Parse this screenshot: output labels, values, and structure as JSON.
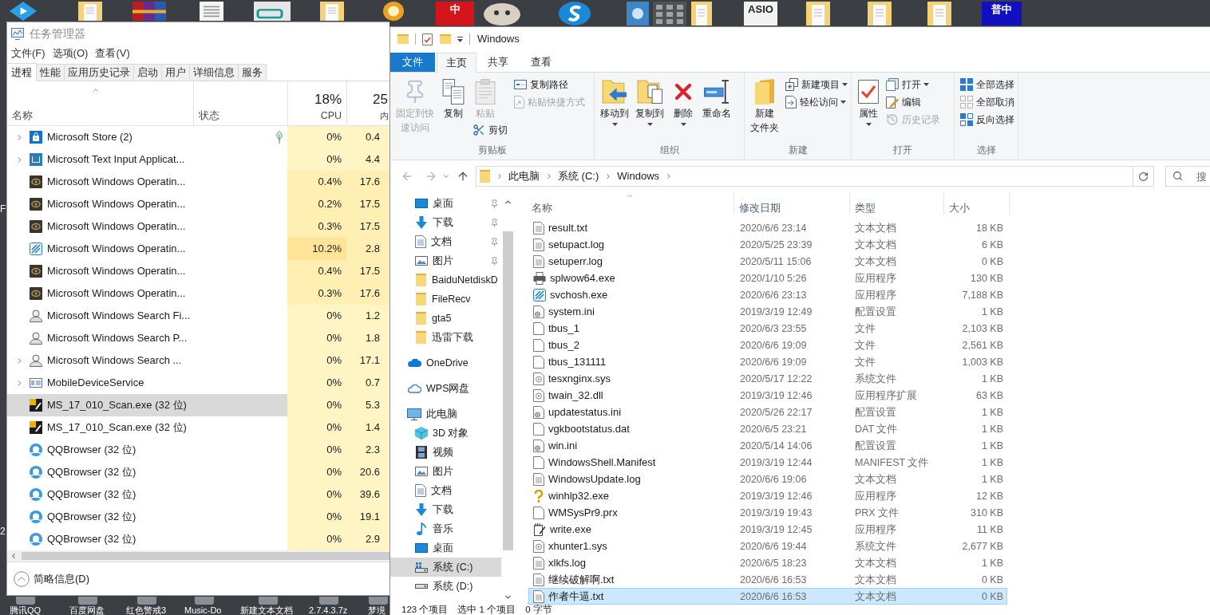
{
  "desktop": {
    "top_icons": [
      {
        "kind": "arrow"
      },
      {
        "kind": "folder"
      },
      {
        "kind": "archive"
      },
      {
        "kind": "document"
      },
      {
        "kind": "usb"
      },
      {
        "kind": "folder"
      },
      {
        "kind": "coin"
      },
      {
        "kind": "badge",
        "text": "中",
        "color": "#d4161c"
      },
      {
        "kind": "mascot"
      },
      {
        "kind": "swirl"
      },
      {
        "kind": "speaker"
      },
      {
        "kind": "keypad"
      },
      {
        "kind": "folder"
      },
      {
        "kind": "badge",
        "text": "ASIO",
        "color": "#f2f2f2"
      },
      {
        "kind": "folder"
      },
      {
        "kind": "folder"
      },
      {
        "kind": "folder"
      },
      {
        "kind": "badge",
        "text": "普中",
        "color": "#1010c0"
      }
    ],
    "edge_labels": [
      "F",
      "2"
    ],
    "bottom_labels": [
      "腾讯QQ",
      "百度网盘",
      "红色警戒3",
      "Music-Do",
      "新建文本文档",
      "2.7.4.3.7z",
      "梦境"
    ]
  },
  "task_manager": {
    "title": "任务管理器",
    "menu": [
      "文件(F)",
      "选项(O)",
      "查看(V)"
    ],
    "tabs": [
      {
        "label": "进程",
        "selected": true
      },
      {
        "label": "性能",
        "selected": false
      },
      {
        "label": "应用历史记录",
        "selected": false
      },
      {
        "label": "启动",
        "selected": false
      },
      {
        "label": "用户",
        "selected": false
      },
      {
        "label": "详细信息",
        "selected": false
      },
      {
        "label": "服务",
        "selected": false
      }
    ],
    "columns": {
      "name": "名称",
      "status": "状态",
      "cpu_usage": "18%",
      "cpu": "CPU",
      "memory_usage": "25",
      "memory": "内"
    },
    "processes": [
      {
        "kind": "store",
        "name": "Microsoft Store (2)",
        "expandable": true,
        "suspended": true,
        "selected": false,
        "cpu": {
          "value": "0%",
          "color": "#fff4c4"
        },
        "memory": {
          "value": "0.4",
          "color": "#fff4c4"
        }
      },
      {
        "kind": "keyboard",
        "name": "Microsoft Text Input Applicat...",
        "expandable": true,
        "suspended": false,
        "selected": false,
        "cpu": {
          "value": "0%",
          "color": "#fff4c4"
        },
        "memory": {
          "value": "4.4",
          "color": "#fff4c4"
        }
      },
      {
        "kind": "eye",
        "name": "Microsoft Windows Operatin...",
        "expandable": false,
        "suspended": false,
        "selected": false,
        "cpu": {
          "value": "0.4%",
          "color": "#ffefb3"
        },
        "memory": {
          "value": "17.6",
          "color": "#ffefb3"
        }
      },
      {
        "kind": "eye",
        "name": "Microsoft Windows Operatin...",
        "expandable": false,
        "suspended": false,
        "selected": false,
        "cpu": {
          "value": "0.2%",
          "color": "#ffefb3"
        },
        "memory": {
          "value": "17.5",
          "color": "#ffefb3"
        }
      },
      {
        "kind": "eye",
        "name": "Microsoft Windows Operatin...",
        "expandable": false,
        "suspended": false,
        "selected": false,
        "cpu": {
          "value": "0.3%",
          "color": "#ffefb3"
        },
        "memory": {
          "value": "17.5",
          "color": "#ffefb3"
        }
      },
      {
        "kind": "stripes",
        "name": "Microsoft Windows Operatin...",
        "expandable": false,
        "suspended": false,
        "selected": false,
        "cpu": {
          "value": "10.2%",
          "color": "#ffe397"
        },
        "memory": {
          "value": "2.8",
          "color": "#ffefb3"
        }
      },
      {
        "kind": "eye",
        "name": "Microsoft Windows Operatin...",
        "expandable": false,
        "suspended": false,
        "selected": false,
        "cpu": {
          "value": "0.4%",
          "color": "#ffefb3"
        },
        "memory": {
          "value": "17.5",
          "color": "#ffefb3"
        }
      },
      {
        "kind": "eye",
        "name": "Microsoft Windows Operatin...",
        "expandable": false,
        "suspended": false,
        "selected": false,
        "cpu": {
          "value": "0.3%",
          "color": "#ffefb3"
        },
        "memory": {
          "value": "17.6",
          "color": "#ffefb3"
        }
      },
      {
        "kind": "user",
        "name": "Microsoft Windows Search Fi...",
        "expandable": false,
        "suspended": false,
        "selected": false,
        "cpu": {
          "value": "0%",
          "color": "#fff4c4"
        },
        "memory": {
          "value": "1.2",
          "color": "#fff4c4"
        }
      },
      {
        "kind": "user",
        "name": "Microsoft Windows Search P...",
        "expandable": false,
        "suspended": false,
        "selected": false,
        "cpu": {
          "value": "0%",
          "color": "#fff4c4"
        },
        "memory": {
          "value": "1.8",
          "color": "#fff4c4"
        }
      },
      {
        "kind": "user",
        "name": "Microsoft Windows Search ...",
        "expandable": true,
        "suspended": false,
        "selected": false,
        "cpu": {
          "value": "0%",
          "color": "#fff4c4"
        },
        "memory": {
          "value": "17.1",
          "color": "#fff4c4"
        }
      },
      {
        "kind": "service",
        "name": "MobileDeviceService",
        "expandable": true,
        "suspended": false,
        "selected": false,
        "cpu": {
          "value": "0%",
          "color": "#fff4c4"
        },
        "memory": {
          "value": "0.7",
          "color": "#fff4c4"
        }
      },
      {
        "kind": "scan",
        "name": "MS_17_010_Scan.exe (32 位)",
        "expandable": false,
        "suspended": false,
        "selected": true,
        "cpu": {
          "value": "0%",
          "color": "#fff4c4"
        },
        "memory": {
          "value": "5.3",
          "color": "#fff4c4"
        }
      },
      {
        "kind": "scan",
        "name": "MS_17_010_Scan.exe (32 位)",
        "expandable": false,
        "suspended": false,
        "selected": false,
        "cpu": {
          "value": "0%",
          "color": "#fff4c4"
        },
        "memory": {
          "value": "1.4",
          "color": "#fff4c4"
        }
      },
      {
        "kind": "browser",
        "name": "QQBrowser (32 位)",
        "expandable": false,
        "suspended": false,
        "selected": false,
        "cpu": {
          "value": "0%",
          "color": "#fff4c4"
        },
        "memory": {
          "value": "2.3",
          "color": "#fff4c4"
        }
      },
      {
        "kind": "browser",
        "name": "QQBrowser (32 位)",
        "expandable": false,
        "suspended": false,
        "selected": false,
        "cpu": {
          "value": "0%",
          "color": "#fff4c4"
        },
        "memory": {
          "value": "20.6",
          "color": "#fff4c4"
        }
      },
      {
        "kind": "browser",
        "name": "QQBrowser (32 位)",
        "expandable": false,
        "suspended": false,
        "selected": false,
        "cpu": {
          "value": "0%",
          "color": "#fff4c4"
        },
        "memory": {
          "value": "39.6",
          "color": "#fff4c4"
        }
      },
      {
        "kind": "browser",
        "name": "QQBrowser (32 位)",
        "expandable": false,
        "suspended": false,
        "selected": false,
        "cpu": {
          "value": "0%",
          "color": "#fff4c4"
        },
        "memory": {
          "value": "19.1",
          "color": "#fff4c4"
        }
      },
      {
        "kind": "browser",
        "name": "QQBrowser (32 位)",
        "expandable": false,
        "suspended": false,
        "selected": false,
        "cpu": {
          "value": "0%",
          "color": "#fff4c4"
        },
        "memory": {
          "value": "2.9",
          "color": "#fff4c4"
        }
      }
    ],
    "footer": "简略信息(D)"
  },
  "explorer": {
    "title": "Windows",
    "file_menu": "文件",
    "tabs": [
      {
        "label": "主页",
        "selected": true
      },
      {
        "label": "共享",
        "selected": false
      },
      {
        "label": "查看",
        "selected": false
      }
    ],
    "ribbon": [
      {
        "label": "剪贴板",
        "columns": [
          {
            "large": {
              "label": "固定到快速访问",
              "kind": "pin",
              "disabled": true,
              "dropdown": false
            }
          },
          {
            "large": {
              "label": "复制",
              "kind": "copy",
              "disabled": false,
              "dropdown": false
            }
          },
          {
            "large": {
              "label": "粘贴",
              "kind": "paste",
              "disabled": true,
              "dropdown": false
            },
            "small": [
              {
                "label": "剪切",
                "kind": "scissors",
                "disabled": false,
                "dropdown": false
              }
            ]
          },
          {
            "small": [
              {
                "label": "复制路径",
                "kind": "path",
                "disabled": false,
                "dropdown": false
              },
              {
                "label": "粘贴快捷方式",
                "kind": "shortcut",
                "disabled": true,
                "dropdown": false
              }
            ]
          }
        ]
      },
      {
        "label": "组织",
        "columns": [
          {
            "large": {
              "label": "移动到",
              "kind": "move",
              "disabled": false,
              "dropdown": true
            }
          },
          {
            "large": {
              "label": "复制到",
              "kind": "copyto",
              "disabled": false,
              "dropdown": true
            }
          },
          {
            "large": {
              "label": "删除",
              "kind": "delete",
              "disabled": false,
              "dropdown": true
            }
          },
          {
            "large": {
              "label": "重命名",
              "kind": "rename",
              "disabled": false,
              "dropdown": false
            }
          }
        ]
      },
      {
        "label": "新建",
        "columns": [
          {
            "large": {
              "lines": [
                "新建",
                "文件夹"
              ],
              "kind": "folder",
              "disabled": false,
              "dropdown": false
            }
          },
          {
            "small": [
              {
                "label": "新建项目",
                "kind": "newitem",
                "disabled": false,
                "dropdown": true
              },
              {
                "label": "轻松访问",
                "kind": "access",
                "disabled": false,
                "dropdown": true
              }
            ]
          }
        ]
      },
      {
        "label": "打开",
        "columns": [
          {
            "large": {
              "label": "属性",
              "kind": "properties",
              "disabled": false,
              "dropdown": true
            }
          },
          {
            "small": [
              {
                "label": "打开",
                "kind": "open",
                "disabled": false,
                "dropdown": true
              },
              {
                "label": "编辑",
                "kind": "edit",
                "disabled": false,
                "dropdown": false
              },
              {
                "label": "历史记录",
                "kind": "history",
                "disabled": true,
                "dropdown": false
              }
            ]
          }
        ]
      },
      {
        "label": "选择",
        "columns": [
          {
            "small": [
              {
                "label": "全部选择",
                "kind": "selectall",
                "disabled": false,
                "dropdown": false
              },
              {
                "label": "全部取消",
                "kind": "selectnone",
                "disabled": false,
                "dropdown": false
              },
              {
                "label": "反向选择",
                "kind": "invert",
                "disabled": false,
                "dropdown": false
              }
            ]
          }
        ]
      }
    ],
    "address": {
      "crumbs": [
        "此电脑",
        "系统 (C:)",
        "Windows"
      ]
    },
    "search": {
      "placeholder": "搜"
    },
    "nav_pane": {
      "quick_access": [
        {
          "label": "桌面",
          "kind": "desktop",
          "pinned": true,
          "selected": false
        },
        {
          "label": "下载",
          "kind": "download",
          "pinned": true,
          "selected": false
        },
        {
          "label": "文档",
          "kind": "document",
          "pinned": true,
          "selected": false
        },
        {
          "label": "图片",
          "kind": "picture",
          "pinned": true,
          "selected": false
        },
        {
          "label": "BaiduNetdiskD",
          "kind": "folder",
          "pinned": false,
          "selected": false
        },
        {
          "label": "FileRecv",
          "kind": "folder",
          "pinned": false,
          "selected": false
        },
        {
          "label": "gta5",
          "kind": "folder",
          "pinned": false,
          "selected": false
        },
        {
          "label": "迅雷下载",
          "kind": "folder",
          "pinned": false,
          "selected": false
        }
      ],
      "locations": [
        {
          "label": "OneDrive",
          "kind": "onedrive",
          "selected": false
        },
        {
          "label": "WPS网盘",
          "kind": "cloud",
          "selected": false
        },
        {
          "label": "此电脑",
          "kind": "computer",
          "selected": false,
          "children": [
            {
              "label": "3D 对象",
              "kind": "cube",
              "selected": false
            },
            {
              "label": "视频",
              "kind": "video",
              "selected": false
            },
            {
              "label": "图片",
              "kind": "picture",
              "selected": false
            },
            {
              "label": "文档",
              "kind": "document",
              "selected": false
            },
            {
              "label": "下载",
              "kind": "download",
              "selected": false
            },
            {
              "label": "音乐",
              "kind": "music",
              "selected": false
            },
            {
              "label": "桌面",
              "kind": "desktop",
              "selected": false
            },
            {
              "label": "系统 (C:)",
              "kind": "windows_drive",
              "selected": true
            },
            {
              "label": "系统 (D:)",
              "kind": "drive",
              "selected": false
            }
          ]
        }
      ]
    },
    "columns": [
      "名称",
      "修改日期",
      "类型",
      "大小"
    ],
    "files": [
      {
        "kind": "text",
        "name": "result.txt",
        "modified": "2020/6/6 23:14",
        "type": "文本文档",
        "size": "18 KB",
        "selected": false
      },
      {
        "kind": "text",
        "name": "setupact.log",
        "modified": "2020/5/25 23:39",
        "type": "文本文档",
        "size": "6 KB",
        "selected": false
      },
      {
        "kind": "text",
        "name": "setuperr.log",
        "modified": "2020/5/11 15:06",
        "type": "文本文档",
        "size": "0 KB",
        "selected": false
      },
      {
        "kind": "printer",
        "name": "splwow64.exe",
        "modified": "2020/1/10 5:26",
        "type": "应用程序",
        "size": "130 KB",
        "selected": false
      },
      {
        "kind": "stripes",
        "name": "svchosh.exe",
        "modified": "2020/6/6 23:13",
        "type": "应用程序",
        "size": "7,188 KB",
        "selected": false
      },
      {
        "kind": "settings",
        "name": "system.ini",
        "modified": "2019/3/19 12:49",
        "type": "配置设置",
        "size": "1 KB",
        "selected": false
      },
      {
        "kind": "blank",
        "name": "tbus_1",
        "modified": "2020/6/3 23:55",
        "type": "文件",
        "size": "2,103 KB",
        "selected": false
      },
      {
        "kind": "blank",
        "name": "tbus_2",
        "modified": "2020/6/6 19:09",
        "type": "文件",
        "size": "2,561 KB",
        "selected": false
      },
      {
        "kind": "blank",
        "name": "tbus_131111",
        "modified": "2020/6/6 19:09",
        "type": "文件",
        "size": "1,003 KB",
        "selected": false
      },
      {
        "kind": "system",
        "name": "tesxnginx.sys",
        "modified": "2020/5/17 12:22",
        "type": "系统文件",
        "size": "1 KB",
        "selected": false
      },
      {
        "kind": "system",
        "name": "twain_32.dll",
        "modified": "2019/3/19 12:46",
        "type": "应用程序扩展",
        "size": "63 KB",
        "selected": false
      },
      {
        "kind": "settings",
        "name": "updatestatus.ini",
        "modified": "2020/5/26 22:17",
        "type": "配置设置",
        "size": "1 KB",
        "selected": false
      },
      {
        "kind": "blank",
        "name": "vgkbootstatus.dat",
        "modified": "2020/6/5 23:21",
        "type": "DAT 文件",
        "size": "1 KB",
        "selected": false
      },
      {
        "kind": "settings",
        "name": "win.ini",
        "modified": "2020/5/14 14:06",
        "type": "配置设置",
        "size": "1 KB",
        "selected": false
      },
      {
        "kind": "blank",
        "name": "WindowsShell.Manifest",
        "modified": "2019/3/19 12:44",
        "type": "MANIFEST 文件",
        "size": "1 KB",
        "selected": false
      },
      {
        "kind": "text",
        "name": "WindowsUpdate.log",
        "modified": "2020/6/6 19:06",
        "type": "文本文档",
        "size": "1 KB",
        "selected": false
      },
      {
        "kind": "help",
        "name": "winhlp32.exe",
        "modified": "2019/3/19 12:46",
        "type": "应用程序",
        "size": "12 KB",
        "selected": false
      },
      {
        "kind": "blank",
        "name": "WMSysPr9.prx",
        "modified": "2019/3/19 19:43",
        "type": "PRX 文件",
        "size": "310 KB",
        "selected": false
      },
      {
        "kind": "write",
        "name": "write.exe",
        "modified": "2019/3/19 12:45",
        "type": "应用程序",
        "size": "11 KB",
        "selected": false
      },
      {
        "kind": "system",
        "name": "xhunter1.sys",
        "modified": "2020/6/6 19:44",
        "type": "系统文件",
        "size": "2,677 KB",
        "selected": false
      },
      {
        "kind": "text",
        "name": "xlkfs.log",
        "modified": "2020/6/5 18:23",
        "type": "文本文档",
        "size": "1 KB",
        "selected": false
      },
      {
        "kind": "text",
        "name": "继续破解啊.txt",
        "modified": "2020/6/6 16:53",
        "type": "文本文档",
        "size": "0 KB",
        "selected": false
      },
      {
        "kind": "text",
        "name": "作者牛逼.txt",
        "modified": "2020/6/6 16:53",
        "type": "文本文档",
        "size": "0 KB",
        "selected": true
      }
    ],
    "status": [
      "123 个项目",
      "选中 1 个项目",
      "0 字节"
    ]
  }
}
